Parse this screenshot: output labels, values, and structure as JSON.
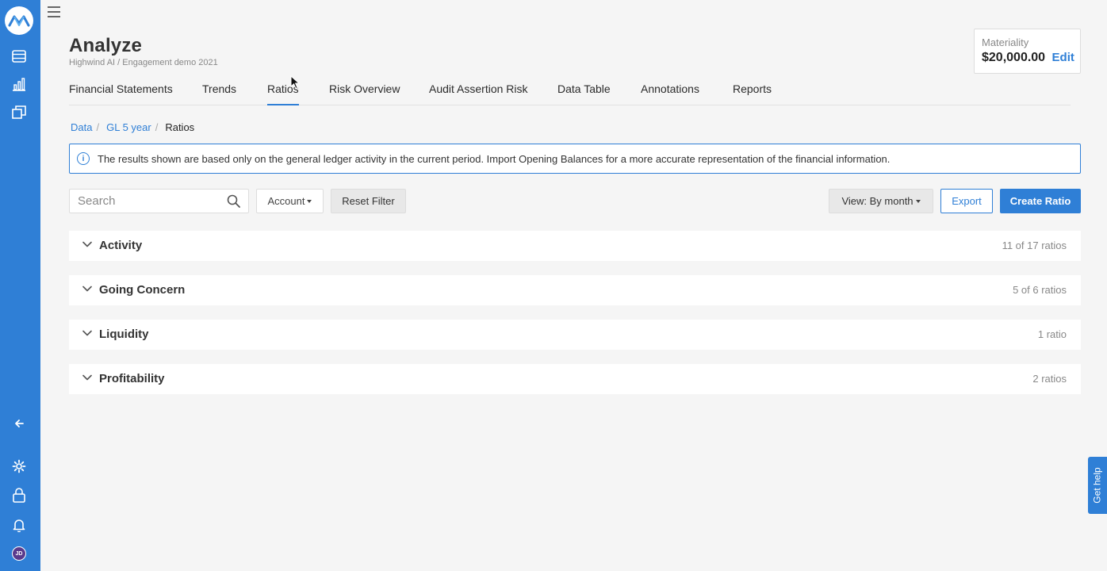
{
  "app": {
    "accent_color": "#2f7fd6",
    "logo_icon": "logo-icon"
  },
  "sidebar": {
    "icons": [
      "logo-icon",
      "database-icon",
      "bar-chart-icon",
      "layers-icon",
      "arrow-left-icon",
      "gear-icon",
      "lock-icon",
      "bell-icon"
    ],
    "avatar_initials": "JD"
  },
  "header": {
    "title": "Analyze",
    "subtitle": "Highwind AI / Engagement demo 2021"
  },
  "materiality": {
    "label": "Materiality",
    "value": "$20,000.00",
    "edit_label": "Edit"
  },
  "tabs": [
    {
      "label": "Financial Statements"
    },
    {
      "label": "Trends"
    },
    {
      "label": "Ratios",
      "active": true
    },
    {
      "label": "Risk Overview"
    },
    {
      "label": "Audit Assertion Risk"
    },
    {
      "label": "Data Table"
    },
    {
      "label": "Annotations"
    },
    {
      "label": "Reports"
    }
  ],
  "breadcrumb": {
    "items": [
      "Data",
      "GL 5 year"
    ],
    "current": "Ratios",
    "separator": "/"
  },
  "alert": {
    "icon": "info-icon",
    "text": "The results shown are based only on the general ledger activity in the current period. Import Opening Balances for a more accurate representation of the financial information."
  },
  "toolbar": {
    "search_placeholder": "Search",
    "account_label": "Account",
    "reset_label": "Reset Filter",
    "view_label": "View: By month",
    "export_label": "Export",
    "create_label": "Create Ratio"
  },
  "groups": [
    {
      "name": "Activity",
      "count": "11 of 17 ratios"
    },
    {
      "name": "Going Concern",
      "count": "5 of 6 ratios"
    },
    {
      "name": "Liquidity",
      "count": "1 ratio"
    },
    {
      "name": "Profitability",
      "count": "2 ratios"
    }
  ],
  "help": {
    "label": "Get help"
  }
}
